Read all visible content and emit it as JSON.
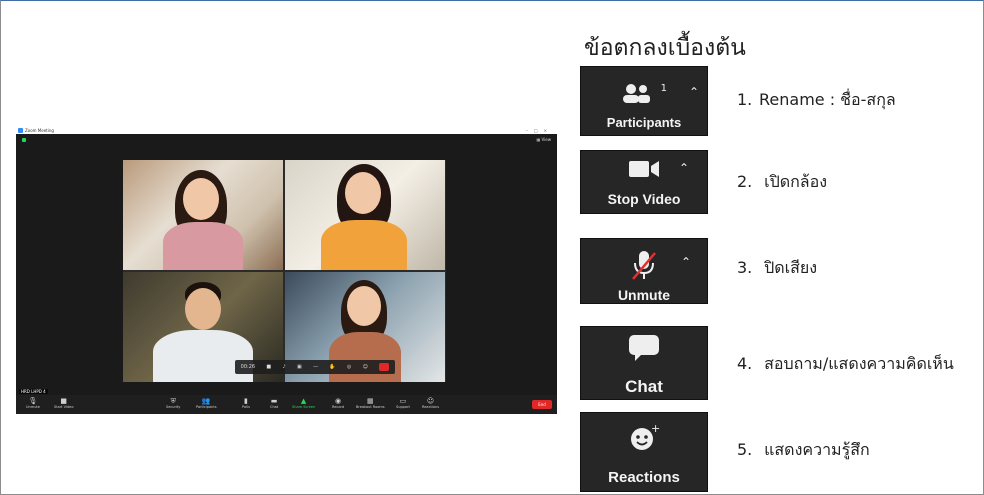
{
  "zoom_window": {
    "title": "Zoom Meeting",
    "view_label": "View",
    "name_tag": "HRD LHPD 4",
    "toolbar": [
      {
        "label": "Unmute",
        "icon": "mic-muted-icon"
      },
      {
        "label": "Start Video",
        "icon": "video-icon"
      },
      {
        "label": "Security",
        "icon": "shield-icon"
      },
      {
        "label": "Participants",
        "icon": "participants-icon"
      },
      {
        "label": "Polls",
        "icon": "polls-icon"
      },
      {
        "label": "Chat",
        "icon": "chat-icon"
      },
      {
        "label": "Share Screen",
        "icon": "share-screen-icon"
      },
      {
        "label": "Record",
        "icon": "record-icon"
      },
      {
        "label": "Breakout Rooms",
        "icon": "breakout-rooms-icon"
      },
      {
        "label": "Support",
        "icon": "support-icon"
      },
      {
        "label": "Reactions",
        "icon": "reactions-icon"
      }
    ],
    "end_label": "End",
    "participant_count": "1"
  },
  "instructions": {
    "heading": "ข้อตกลงเบื้องต้น",
    "items": [
      {
        "number": "1.",
        "text": "Rename : ชื่อ-สกุล",
        "card_label": "Participants",
        "card_icon": "participants-icon",
        "card_count": "1"
      },
      {
        "number": "2.",
        "text": "เปิดกล้อง",
        "card_label": "Stop Video",
        "card_icon": "video-camera-icon"
      },
      {
        "number": "3.",
        "text": "ปิดเสียง",
        "card_label": "Unmute",
        "card_icon": "mic-muted-icon"
      },
      {
        "number": "4.",
        "text": "สอบถาม/แสดงความคิดเห็น",
        "card_label": "Chat",
        "card_icon": "chat-icon"
      },
      {
        "number": "5.",
        "text": "แสดงความรู้สึก",
        "card_label": "Reactions",
        "card_icon": "reactions-icon"
      }
    ]
  }
}
